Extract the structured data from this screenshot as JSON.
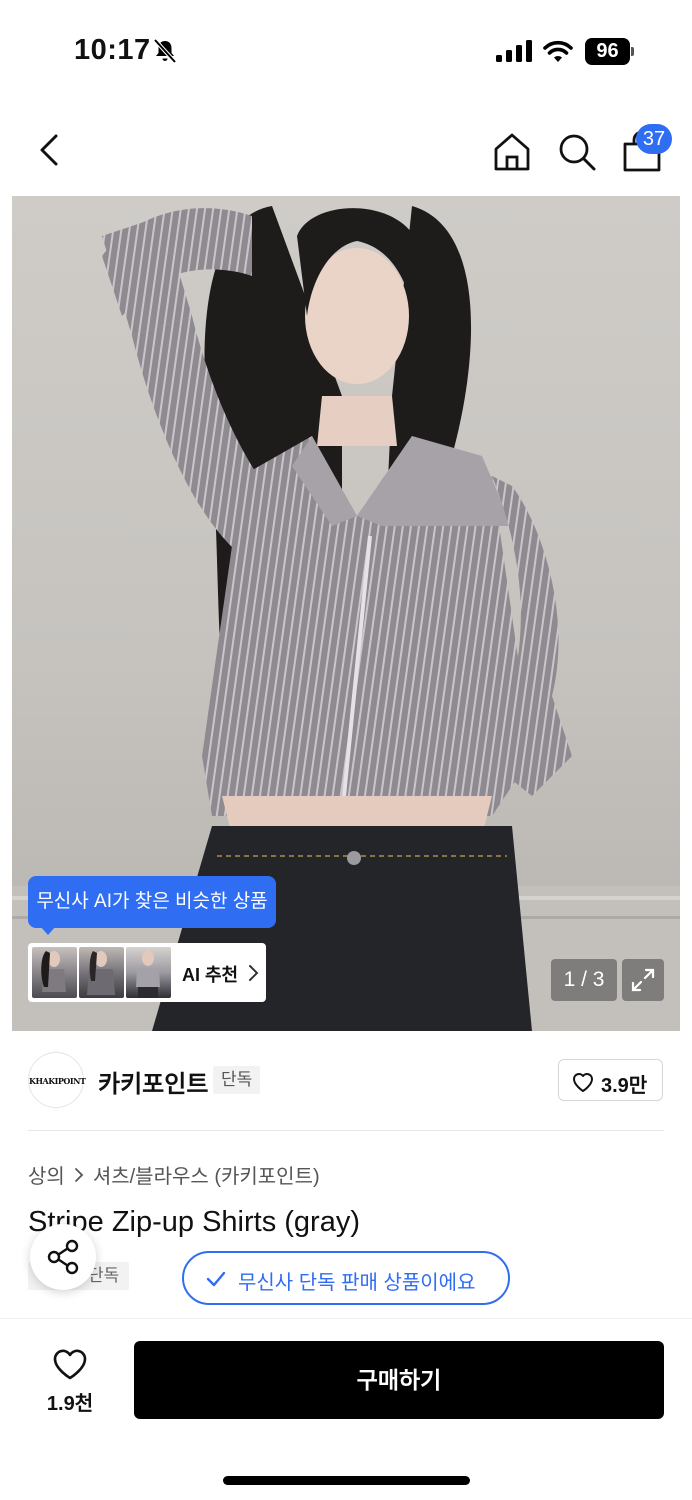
{
  "status_bar": {
    "time": "10:17",
    "battery": "96"
  },
  "nav": {
    "cart_count": "37",
    "icons": [
      "back-chevron-icon",
      "home-icon",
      "search-icon",
      "shopping-bag-icon"
    ]
  },
  "image": {
    "ai_tooltip": "무신사 AI가 찾은 비슷한 상품",
    "ai_label": "AI 추천",
    "page_indicator": "1 / 3"
  },
  "brand": {
    "logo_text": "KHAKIPOINT",
    "name": "카키포인트",
    "tag": "단독",
    "like_count": "3.9만"
  },
  "breadcrumb": [
    "상의",
    "셔츠/블라우스 (카키포인트)"
  ],
  "product": {
    "title": "Stripe Zip-up Shirts (gray)",
    "small_tag": "단독",
    "exclusive_badge": "무신사 단독 판매 상품이에요"
  },
  "bottom_bar": {
    "wish_count": "1.9천",
    "buy_label": "구매하기"
  },
  "colors": {
    "accent": "#2f6df3",
    "buy_button": "#000000"
  }
}
